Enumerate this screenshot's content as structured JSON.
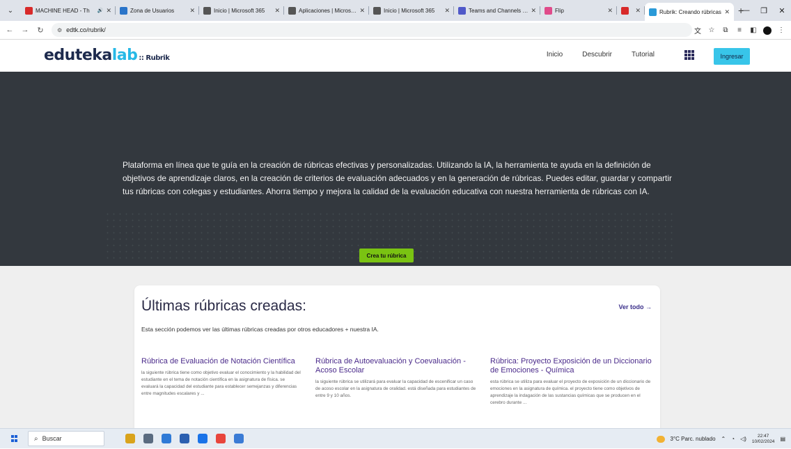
{
  "browser": {
    "tabs": [
      {
        "title": "MACHINE HEAD - Th",
        "color": "#d82a2a",
        "active": false,
        "width": 136,
        "extra": "🔊"
      },
      {
        "title": "Zona de Usuarios",
        "color": "#2a74c9",
        "active": false,
        "width": 120
      },
      {
        "title": "Inicio | Microsoft 365",
        "color": "#555555",
        "active": false,
        "width": 122
      },
      {
        "title": "Aplicaciones | Microsoft",
        "color": "#555555",
        "active": false,
        "width": 122
      },
      {
        "title": "Inicio | Microsoft 365",
        "color": "#555555",
        "active": false,
        "width": 122
      },
      {
        "title": "Teams and Channels | Go",
        "color": "#5059c9",
        "active": false,
        "width": 124
      },
      {
        "title": "Flip",
        "color": "#e04b8a",
        "active": false,
        "width": 110
      },
      {
        "title": "",
        "color": "#d82a2a",
        "active": false,
        "width": 40
      },
      {
        "title": "Rubrik: Creando rúbricas",
        "color": "#2a9ad8",
        "active": true,
        "width": 128
      }
    ],
    "url": "edtk.co/rubrik/",
    "new_tab": "+",
    "close_symbol": "✕"
  },
  "site": {
    "logo_main": "edutekalab",
    "logo_sub": ":: Rubrik",
    "nav": [
      "Inicio",
      "Descubrir",
      "Tutorial"
    ],
    "login": "Ingresar"
  },
  "hero": {
    "text": "Plataforma en línea que te guía en la creación de rúbricas efectivas y personalizadas. Utilizando la IA, la herramienta te ayuda en la definición de objetivos de aprendizaje claros, en la creación de criterios de evaluación adecuados y en la generación de rúbricas. Puedes editar, guardar y compartir tus rúbricas con colegas y estudiantes. Ahorra tiempo y mejora la calidad de la evaluación educativa con nuestra herramienta de rúbricas con IA.",
    "cta": "Crea tu rúbrica"
  },
  "latest": {
    "title": "Últimas rúbricas creadas:",
    "see_all": "Ver todo →",
    "intro": "Esta sección podemos ver las últimas rúbricas creadas por otros educadores + nuestra IA.",
    "items": [
      {
        "title": "Rúbrica de Evaluación de Notación Científica",
        "desc": "la siguiente rúbrica tiene como objetivo evaluar el conocimiento y la habilidad del estudiante en el tema de notación científica en la asignatura de física. se evaluará la capacidad del estudiante para establecer semejanzas y diferencias entre magnitudes escalares y ..."
      },
      {
        "title": "Rúbrica de Autoevaluación y Coevaluación - Acoso Escolar",
        "desc": "la siguiente rúbrica se utilizará para evaluar la capacidad de escenificar un caso de acoso escolar en la asignatura de oralidad. está diseñada para estudiantes de entre 9 y 10 años."
      },
      {
        "title": "Rúbrica: Proyecto Exposición de un Diccionario de Emociones - Química",
        "desc": "esta rúbrica se utiliza para evaluar el proyecto de exposición de un diccionario de emociones en la asignatura de química. el proyecto tiene como objetivos de aprendizaje la indagación de las sustancias químicas que se producen en el cerebro durante ..."
      }
    ]
  },
  "taskbar": {
    "search_placeholder": "Buscar",
    "weather": "3°C  Parc. nublado",
    "time": "22:47",
    "date": "10/02/2024",
    "app_colors": [
      "#d9a31c",
      "#5a6b80",
      "#2f7ad6",
      "#2b5fb0",
      "#1a73e8",
      "#e8453c",
      "#3a7bd5"
    ]
  }
}
